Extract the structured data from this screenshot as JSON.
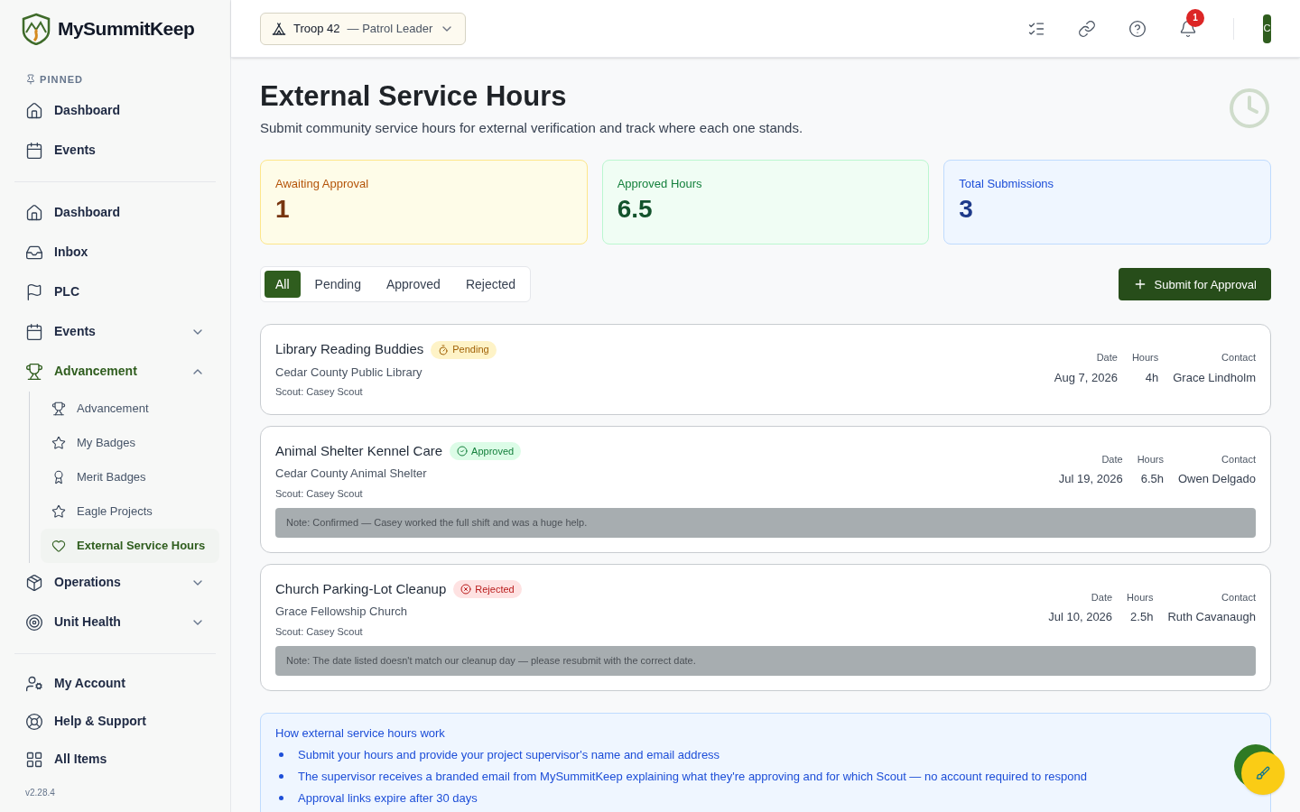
{
  "brand": {
    "name": "MySummitKeep"
  },
  "sidebar": {
    "pinned_label": "PINNED",
    "pinned": [
      {
        "label": "Dashboard",
        "selected": false
      },
      {
        "label": "Events",
        "selected": false
      }
    ],
    "nav": [
      {
        "label": "Dashboard",
        "selected": false
      },
      {
        "label": "Inbox",
        "selected": false
      },
      {
        "label": "PLC",
        "selected": false
      },
      {
        "label": "Events",
        "selected": false,
        "expanded": false
      },
      {
        "label": "Advancement",
        "selected": true,
        "expanded": true,
        "children": [
          {
            "label": "Advancement",
            "selected": false
          },
          {
            "label": "My Badges",
            "selected": false
          },
          {
            "label": "Merit Badges",
            "selected": false
          },
          {
            "label": "Eagle Projects",
            "selected": false
          },
          {
            "label": "External Service Hours",
            "selected": true
          }
        ]
      },
      {
        "label": "Operations",
        "selected": false,
        "expanded": false
      },
      {
        "label": "Unit Health",
        "selected": false,
        "expanded": false
      }
    ],
    "footer": [
      {
        "label": "My Account"
      },
      {
        "label": "Help & Support"
      },
      {
        "label": "All Items"
      }
    ],
    "version": "v2.28.4"
  },
  "header": {
    "unit": "Troop 42",
    "role": "— Patrol Leader",
    "notifications": "1",
    "avatar": "C"
  },
  "page": {
    "title": "External Service Hours",
    "subtitle": "Submit community service hours for external verification and track where each one stands."
  },
  "stats": [
    {
      "kind": "pending",
      "label": "Awaiting Approval",
      "value": "1"
    },
    {
      "kind": "approved",
      "label": "Approved Hours",
      "value": "6.5"
    },
    {
      "kind": "total",
      "label": "Total Submissions",
      "value": "3"
    }
  ],
  "tabs": [
    {
      "label": "All",
      "selected": true
    },
    {
      "label": "Pending",
      "selected": false
    },
    {
      "label": "Approved",
      "selected": false
    },
    {
      "label": "Rejected",
      "selected": false
    }
  ],
  "submit_button": "Submit for Approval",
  "submissions": [
    {
      "title": "Library Reading Buddies",
      "kind": "pending",
      "date_label": "Date",
      "hours_label": "Hours",
      "contact_label": "Contact",
      "status_label": "Pending",
      "org": "Cedar County Public Library",
      "scout": "Scout: Casey Scout",
      "date": "Aug 7, 2026",
      "hours": "4h",
      "contact": "Grace Lindholm"
    },
    {
      "title": "Animal Shelter Kennel Care",
      "kind": "approved",
      "date_label": "Date",
      "hours_label": "Hours",
      "contact_label": "Contact",
      "status_label": "Approved",
      "org": "Cedar County Animal Shelter",
      "scout": "Scout: Casey Scout",
      "date": "Jul 19, 2026",
      "hours": "6.5h",
      "contact": "Owen Delgado",
      "note": "Note: Confirmed — Casey worked the full shift and was a huge help."
    },
    {
      "title": "Church Parking-Lot Cleanup",
      "kind": "rejected",
      "date_label": "Date",
      "hours_label": "Hours",
      "contact_label": "Contact",
      "status_label": "Rejected",
      "org": "Grace Fellowship Church",
      "scout": "Scout: Casey Scout",
      "date": "Jul 10, 2026",
      "hours": "2.5h",
      "contact": "Ruth Cavanaugh",
      "note": "Note: The date listed doesn't match our cleanup day — please resubmit with the correct date."
    }
  ],
  "info": {
    "title": "How external service hours work",
    "items": [
      "Submit your hours and provide your project supervisor's name and email address",
      "The supervisor receives a branded email from MySummitKeep explaining what they're approving and for which Scout — no account required to respond",
      "Approval links expire after 30 days"
    ]
  }
}
